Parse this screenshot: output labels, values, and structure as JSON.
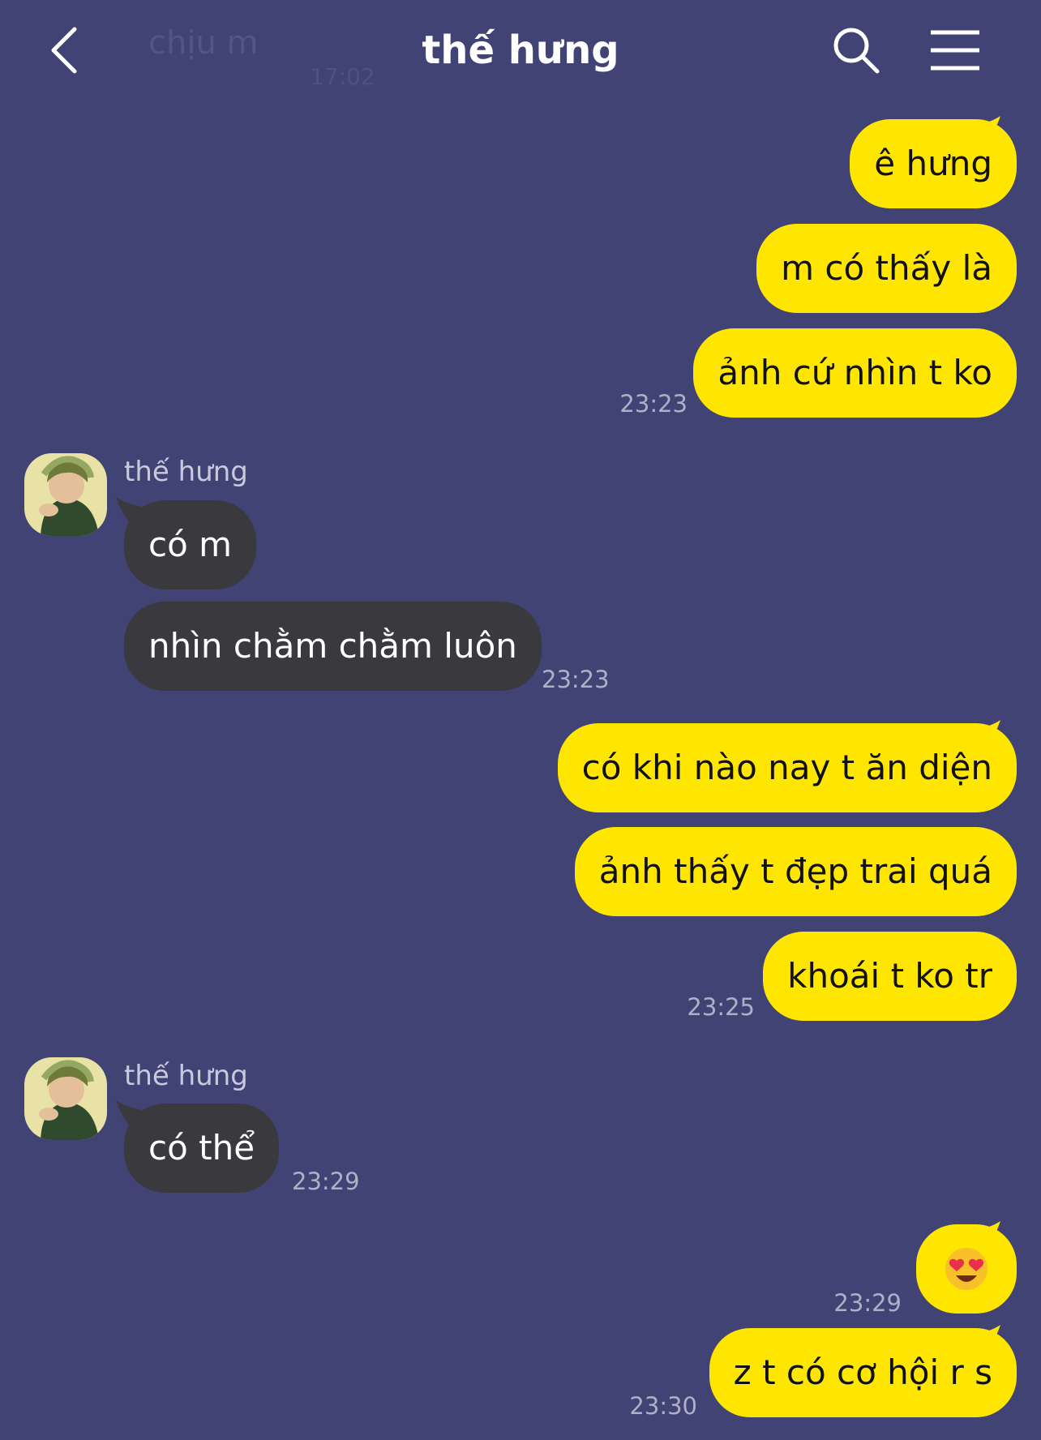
{
  "header": {
    "title": "thế hưng",
    "ghost_preview": "chịu m",
    "ghost_time": "17:02"
  },
  "messages": {
    "m1": "ê hưng",
    "m2": "m có thấy là",
    "m3": "ảnh cứ nhìn t ko",
    "t1": "23:23",
    "sender1": "thế hưng",
    "m4": "có m",
    "m5": "nhìn chằm chằm luôn",
    "t2": "23:23",
    "m6": "có khi nào nay t ăn diện",
    "m7": "ảnh thấy t đẹp trai quá",
    "m8": "khoái t ko tr",
    "t3": "23:25",
    "sender2": "thế hưng",
    "m9": "có thể",
    "t4": "23:29",
    "m10_emoji": "😍",
    "t5": "23:29",
    "m11": "z t có cơ hội r s",
    "t6": "23:30"
  },
  "colors": {
    "background": "#404374",
    "outgoing_bubble": "#ffe600",
    "incoming_bubble": "#3a3a3e",
    "timestamp": "#aeb0c8"
  },
  "icons": [
    "back-arrow-icon",
    "search-icon",
    "menu-icon",
    "contact-avatar",
    "heart-eyes-emoji"
  ]
}
